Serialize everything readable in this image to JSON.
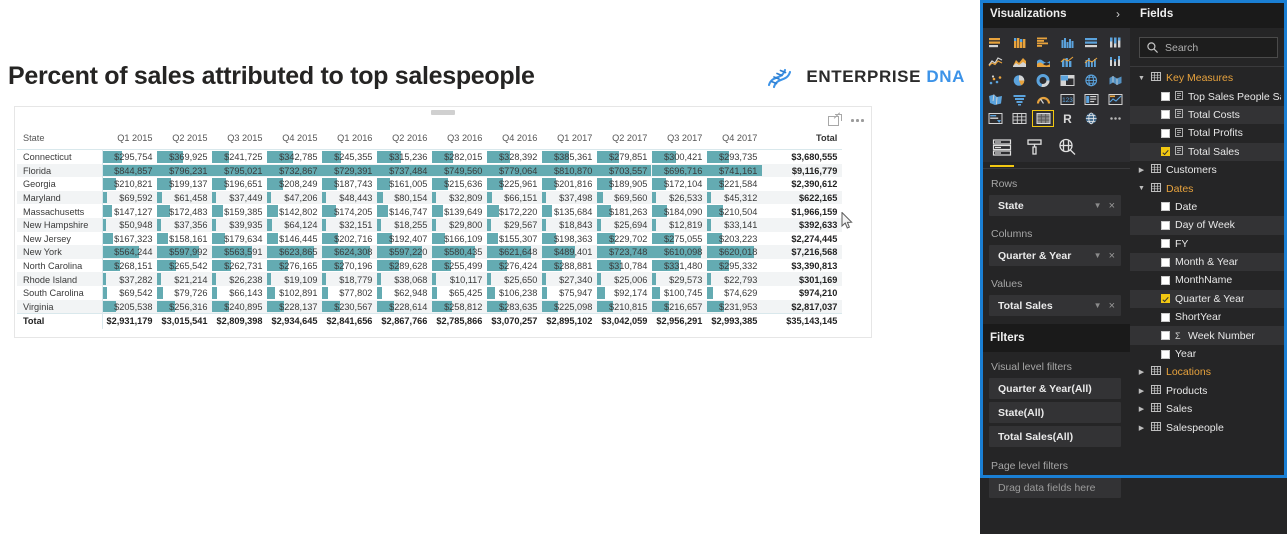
{
  "report": {
    "title": "Percent of sales attributed to top salespeople",
    "brand": {
      "part1": "ENTERPRISE",
      "part2": "DNA",
      "logo_icon": "dna-helix-icon"
    }
  },
  "visual": {
    "focus_icon": "focus-mode-icon",
    "more_icon": "more-options-icon",
    "grip_icon": "drag-handle-icon",
    "bar_color": "#64abb2",
    "columns": [
      "State",
      "Q1 2015",
      "Q2 2015",
      "Q3 2015",
      "Q4 2015",
      "Q1 2016",
      "Q2 2016",
      "Q3 2016",
      "Q4 2016",
      "Q1 2017",
      "Q2 2017",
      "Q3 2017",
      "Q4 2017",
      "Total"
    ],
    "rows": [
      {
        "state": "Connecticut",
        "values": [
          "$295,754",
          "$369,925",
          "$241,725",
          "$342,785",
          "$245,355",
          "$315,236",
          "$282,015",
          "$328,392",
          "$385,361",
          "$279,851",
          "$300,421",
          "$293,735"
        ],
        "total": "$3,680,555"
      },
      {
        "state": "Florida",
        "values": [
          "$844,857",
          "$796,231",
          "$795,021",
          "$732,867",
          "$729,391",
          "$737,484",
          "$749,560",
          "$779,064",
          "$810,870",
          "$703,557",
          "$696,716",
          "$741,161"
        ],
        "total": "$9,116,779"
      },
      {
        "state": "Georgia",
        "values": [
          "$210,821",
          "$199,137",
          "$196,651",
          "$208,249",
          "$187,743",
          "$161,005",
          "$215,636",
          "$225,961",
          "$201,816",
          "$189,905",
          "$172,104",
          "$221,584"
        ],
        "total": "$2,390,612"
      },
      {
        "state": "Maryland",
        "values": [
          "$69,592",
          "$61,458",
          "$37,449",
          "$47,206",
          "$48,443",
          "$80,154",
          "$32,809",
          "$66,151",
          "$37,498",
          "$69,560",
          "$26,533",
          "$45,312"
        ],
        "total": "$622,165"
      },
      {
        "state": "Massachusetts",
        "values": [
          "$147,127",
          "$172,483",
          "$159,385",
          "$142,802",
          "$174,205",
          "$146,747",
          "$139,649",
          "$172,220",
          "$135,684",
          "$181,263",
          "$184,090",
          "$210,504"
        ],
        "total": "$1,966,159"
      },
      {
        "state": "New Hampshire",
        "values": [
          "$50,948",
          "$37,356",
          "$39,935",
          "$64,124",
          "$32,151",
          "$18,255",
          "$29,800",
          "$29,567",
          "$18,843",
          "$25,694",
          "$12,819",
          "$33,141"
        ],
        "total": "$392,633"
      },
      {
        "state": "New Jersey",
        "values": [
          "$167,323",
          "$158,161",
          "$179,634",
          "$146,445",
          "$202,716",
          "$192,407",
          "$166,109",
          "$155,307",
          "$198,363",
          "$229,702",
          "$275,055",
          "$203,223"
        ],
        "total": "$2,274,445"
      },
      {
        "state": "New York",
        "values": [
          "$564,244",
          "$597,992",
          "$563,591",
          "$623,865",
          "$624,308",
          "$597,220",
          "$580,435",
          "$621,648",
          "$489,401",
          "$723,748",
          "$610,098",
          "$620,018"
        ],
        "total": "$7,216,568"
      },
      {
        "state": "North Carolina",
        "values": [
          "$268,151",
          "$265,542",
          "$262,731",
          "$276,165",
          "$270,196",
          "$289,628",
          "$255,499",
          "$276,424",
          "$288,881",
          "$310,784",
          "$331,480",
          "$295,332"
        ],
        "total": "$3,390,813"
      },
      {
        "state": "Rhode Island",
        "values": [
          "$37,282",
          "$21,214",
          "$26,238",
          "$19,109",
          "$18,779",
          "$38,068",
          "$10,117",
          "$25,650",
          "$27,340",
          "$25,006",
          "$29,573",
          "$22,793"
        ],
        "total": "$301,169"
      },
      {
        "state": "South Carolina",
        "values": [
          "$69,542",
          "$79,726",
          "$66,143",
          "$102,891",
          "$77,802",
          "$62,948",
          "$65,425",
          "$106,238",
          "$75,947",
          "$92,174",
          "$100,745",
          "$74,629"
        ],
        "total": "$974,210"
      },
      {
        "state": "Virginia",
        "values": [
          "$205,538",
          "$256,316",
          "$240,895",
          "$228,137",
          "$230,567",
          "$228,614",
          "$258,812",
          "$283,635",
          "$225,098",
          "$210,815",
          "$216,657",
          "$231,953"
        ],
        "total": "$2,817,037"
      }
    ],
    "total_row": {
      "label": "Total",
      "values": [
        "$2,931,179",
        "$3,015,541",
        "$2,809,398",
        "$2,934,645",
        "$2,841,656",
        "$2,867,766",
        "$2,785,866",
        "$3,070,257",
        "$2,895,102",
        "$3,042,059",
        "$2,956,291",
        "$2,993,385"
      ],
      "total": "$35,143,145"
    }
  },
  "visualizations": {
    "header": "Visualizations",
    "expand_icon": "chevron-right-icon",
    "selected_visual": "matrix",
    "icons": [
      "stacked-bar-chart-icon",
      "stacked-column-chart-icon",
      "clustered-bar-chart-icon",
      "clustered-column-chart-icon",
      "hundred-stacked-bar-icon",
      "hundred-stacked-column-icon",
      "line-chart-icon",
      "area-chart-icon",
      "stacked-area-chart-icon",
      "line-stacked-column-icon",
      "line-clustered-column-icon",
      "ribbon-chart-icon",
      "scatter-chart-icon",
      "pie-chart-icon",
      "donut-chart-icon",
      "treemap-icon",
      "map-icon",
      "filled-map-icon",
      "shape-map-icon",
      "funnel-icon",
      "gauge-icon",
      "card-icon",
      "multi-row-card-icon",
      "kpi-icon",
      "slicer-icon",
      "table-icon",
      "matrix-icon",
      "r-script-icon",
      "python-visual-icon",
      "more-visuals-icon"
    ],
    "tool_tabs": [
      {
        "name": "fields-pane-icon",
        "active": true
      },
      {
        "name": "format-paint-roller-icon",
        "active": false
      },
      {
        "name": "analytics-magnifier-icon",
        "active": false
      }
    ],
    "wells": [
      {
        "label": "Rows",
        "value": "State"
      },
      {
        "label": "Columns",
        "value": "Quarter & Year"
      },
      {
        "label": "Values",
        "value": "Total Sales"
      }
    ],
    "filters": {
      "header": "Filters",
      "visual_level_label": "Visual level filters",
      "items": [
        "Quarter & Year(All)",
        "State(All)",
        "Total Sales(All)"
      ],
      "page_level_label": "Page level filters",
      "dropzone": "Drag data fields here"
    }
  },
  "fields": {
    "header": "Fields",
    "search_placeholder": "Search",
    "search_icon": "search-icon",
    "tree": [
      {
        "type": "table",
        "label": "Key Measures",
        "expanded": true,
        "highlight": true,
        "icon": "measure-table-icon"
      },
      {
        "type": "field",
        "label": "Top Sales People Sale",
        "checked": false,
        "icon": "measure-icon"
      },
      {
        "type": "field",
        "label": "Total Costs",
        "checked": false,
        "icon": "measure-icon"
      },
      {
        "type": "field",
        "label": "Total Profits",
        "checked": false,
        "icon": "measure-icon"
      },
      {
        "type": "field",
        "label": "Total Sales",
        "checked": true,
        "icon": "measure-icon"
      },
      {
        "type": "table",
        "label": "Customers",
        "expanded": false,
        "highlight": false,
        "icon": "table-icon"
      },
      {
        "type": "table",
        "label": "Dates",
        "expanded": true,
        "highlight": true,
        "icon": "table-icon"
      },
      {
        "type": "field",
        "label": "Date",
        "checked": false
      },
      {
        "type": "field",
        "label": "Day of Week",
        "checked": false
      },
      {
        "type": "field",
        "label": "FY",
        "checked": false
      },
      {
        "type": "field",
        "label": "Month & Year",
        "checked": false
      },
      {
        "type": "field",
        "label": "MonthName",
        "checked": false
      },
      {
        "type": "field",
        "label": "Quarter & Year",
        "checked": true
      },
      {
        "type": "field",
        "label": "ShortYear",
        "checked": false
      },
      {
        "type": "field",
        "label": "Week Number",
        "checked": false,
        "sigma": "Σ"
      },
      {
        "type": "field",
        "label": "Year",
        "checked": false
      },
      {
        "type": "table",
        "label": "Locations",
        "expanded": false,
        "highlight": true,
        "icon": "table-icon"
      },
      {
        "type": "table",
        "label": "Products",
        "expanded": false,
        "highlight": false,
        "icon": "table-icon"
      },
      {
        "type": "table",
        "label": "Sales",
        "expanded": false,
        "highlight": false,
        "icon": "table-icon"
      },
      {
        "type": "table",
        "label": "Salespeople",
        "expanded": false,
        "highlight": false,
        "icon": "table-icon"
      }
    ]
  },
  "chart_data": {
    "type": "table",
    "title": "Percent of sales attributed to top salespeople",
    "categories": [
      "Q1 2015",
      "Q2 2015",
      "Q3 2015",
      "Q4 2015",
      "Q1 2016",
      "Q2 2016",
      "Q3 2016",
      "Q4 2016",
      "Q1 2017",
      "Q2 2017",
      "Q3 2017",
      "Q4 2017"
    ],
    "xlabel": "Quarter & Year",
    "ylabel": "State",
    "value_field": "Total Sales",
    "grand_total": 35143145,
    "series": [
      {
        "name": "Connecticut",
        "values": [
          295754,
          369925,
          241725,
          342785,
          245355,
          315236,
          282015,
          328392,
          385361,
          279851,
          300421,
          293735
        ],
        "total": 3680555
      },
      {
        "name": "Florida",
        "values": [
          844857,
          796231,
          795021,
          732867,
          729391,
          737484,
          749560,
          779064,
          810870,
          703557,
          696716,
          741161
        ],
        "total": 9116779
      },
      {
        "name": "Georgia",
        "values": [
          210821,
          199137,
          196651,
          208249,
          187743,
          161005,
          215636,
          225961,
          201816,
          189905,
          172104,
          221584
        ],
        "total": 2390612
      },
      {
        "name": "Maryland",
        "values": [
          69592,
          61458,
          37449,
          47206,
          48443,
          80154,
          32809,
          66151,
          37498,
          69560,
          26533,
          45312
        ],
        "total": 622165
      },
      {
        "name": "Massachusetts",
        "values": [
          147127,
          172483,
          159385,
          142802,
          174205,
          146747,
          139649,
          172220,
          135684,
          181263,
          184090,
          210504
        ],
        "total": 1966159
      },
      {
        "name": "New Hampshire",
        "values": [
          50948,
          37356,
          39935,
          64124,
          32151,
          18255,
          29800,
          29567,
          18843,
          25694,
          12819,
          33141
        ],
        "total": 392633
      },
      {
        "name": "New Jersey",
        "values": [
          167323,
          158161,
          179634,
          146445,
          202716,
          192407,
          166109,
          155307,
          198363,
          229702,
          275055,
          203223
        ],
        "total": 2274445
      },
      {
        "name": "New York",
        "values": [
          564244,
          597992,
          563591,
          623865,
          624308,
          597220,
          580435,
          621648,
          489401,
          723748,
          610098,
          620018
        ],
        "total": 7216568
      },
      {
        "name": "North Carolina",
        "values": [
          268151,
          265542,
          262731,
          276165,
          270196,
          289628,
          255499,
          276424,
          288881,
          310784,
          331480,
          295332
        ],
        "total": 3390813
      },
      {
        "name": "Rhode Island",
        "values": [
          37282,
          21214,
          26238,
          19109,
          18779,
          38068,
          10117,
          25650,
          27340,
          25006,
          29573,
          22793
        ],
        "total": 301169
      },
      {
        "name": "South Carolina",
        "values": [
          69542,
          79726,
          66143,
          102891,
          77802,
          62948,
          65425,
          106238,
          75947,
          92174,
          100745,
          74629
        ],
        "total": 974210
      },
      {
        "name": "Virginia",
        "values": [
          205538,
          256316,
          240895,
          228137,
          230567,
          228614,
          258812,
          283635,
          225098,
          210815,
          216657,
          231953
        ],
        "total": 2817037
      }
    ],
    "column_totals": [
      2931179,
      3015541,
      2809398,
      2934645,
      2841656,
      2867766,
      2785866,
      3070257,
      2895102,
      3042059,
      2956291,
      2993385
    ]
  }
}
